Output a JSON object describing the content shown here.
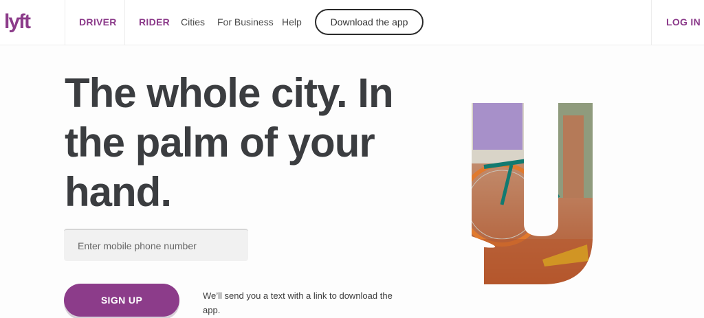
{
  "brand": {
    "logo_text": "lyft",
    "color": "#8c3c8a"
  },
  "nav": {
    "driver": "DRIVER",
    "rider": "RIDER",
    "cities": "Cities",
    "for_business": "For Business",
    "help": "Help",
    "download": "Download the app",
    "login": "LOG IN"
  },
  "hero": {
    "line1": "The whole city. In",
    "line2": "the palm of your",
    "line3": "hand.",
    "image_icon": "bike-y-graphic"
  },
  "form": {
    "phone_placeholder": "Enter mobile phone number",
    "signup_label": "SIGN UP",
    "helper_text": "We’ll send you a text with a link to download the app."
  }
}
